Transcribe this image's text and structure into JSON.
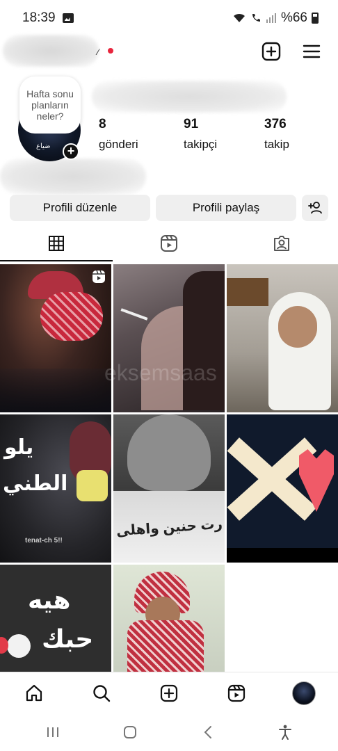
{
  "status_bar": {
    "time": "18:39",
    "battery": "%66"
  },
  "profile": {
    "note_text": "Hafta sonu planların neler?",
    "avatar_caption": "ضياع",
    "stats": [
      {
        "value": "8",
        "label": "gönderi"
      },
      {
        "value": "91",
        "label": "takipçi"
      },
      {
        "value": "376",
        "label": "takip"
      }
    ]
  },
  "actions": {
    "edit_label": "Profili düzenle",
    "share_label": "Profili paylaş"
  },
  "tabs": [
    {
      "icon": "grid-icon",
      "selected": true
    },
    {
      "icon": "reels-icon",
      "selected": false
    },
    {
      "icon": "tagged-icon",
      "selected": false
    }
  ],
  "grid": {
    "cell4_text": [
      "يلو",
      "الطني"
    ],
    "cell4_caption": "tenat-ch 5!!",
    "cell5_text": "رت حنين واهلى",
    "cell7_text": [
      "هيه",
      "حبك"
    ],
    "watermark": "eksemsaas"
  },
  "bottom_nav": [
    "home-icon",
    "search-icon",
    "create-icon",
    "reels-icon",
    "profile-avatar"
  ],
  "colors": {
    "accent_red": "#e8253d",
    "button_bg": "#efefef"
  }
}
